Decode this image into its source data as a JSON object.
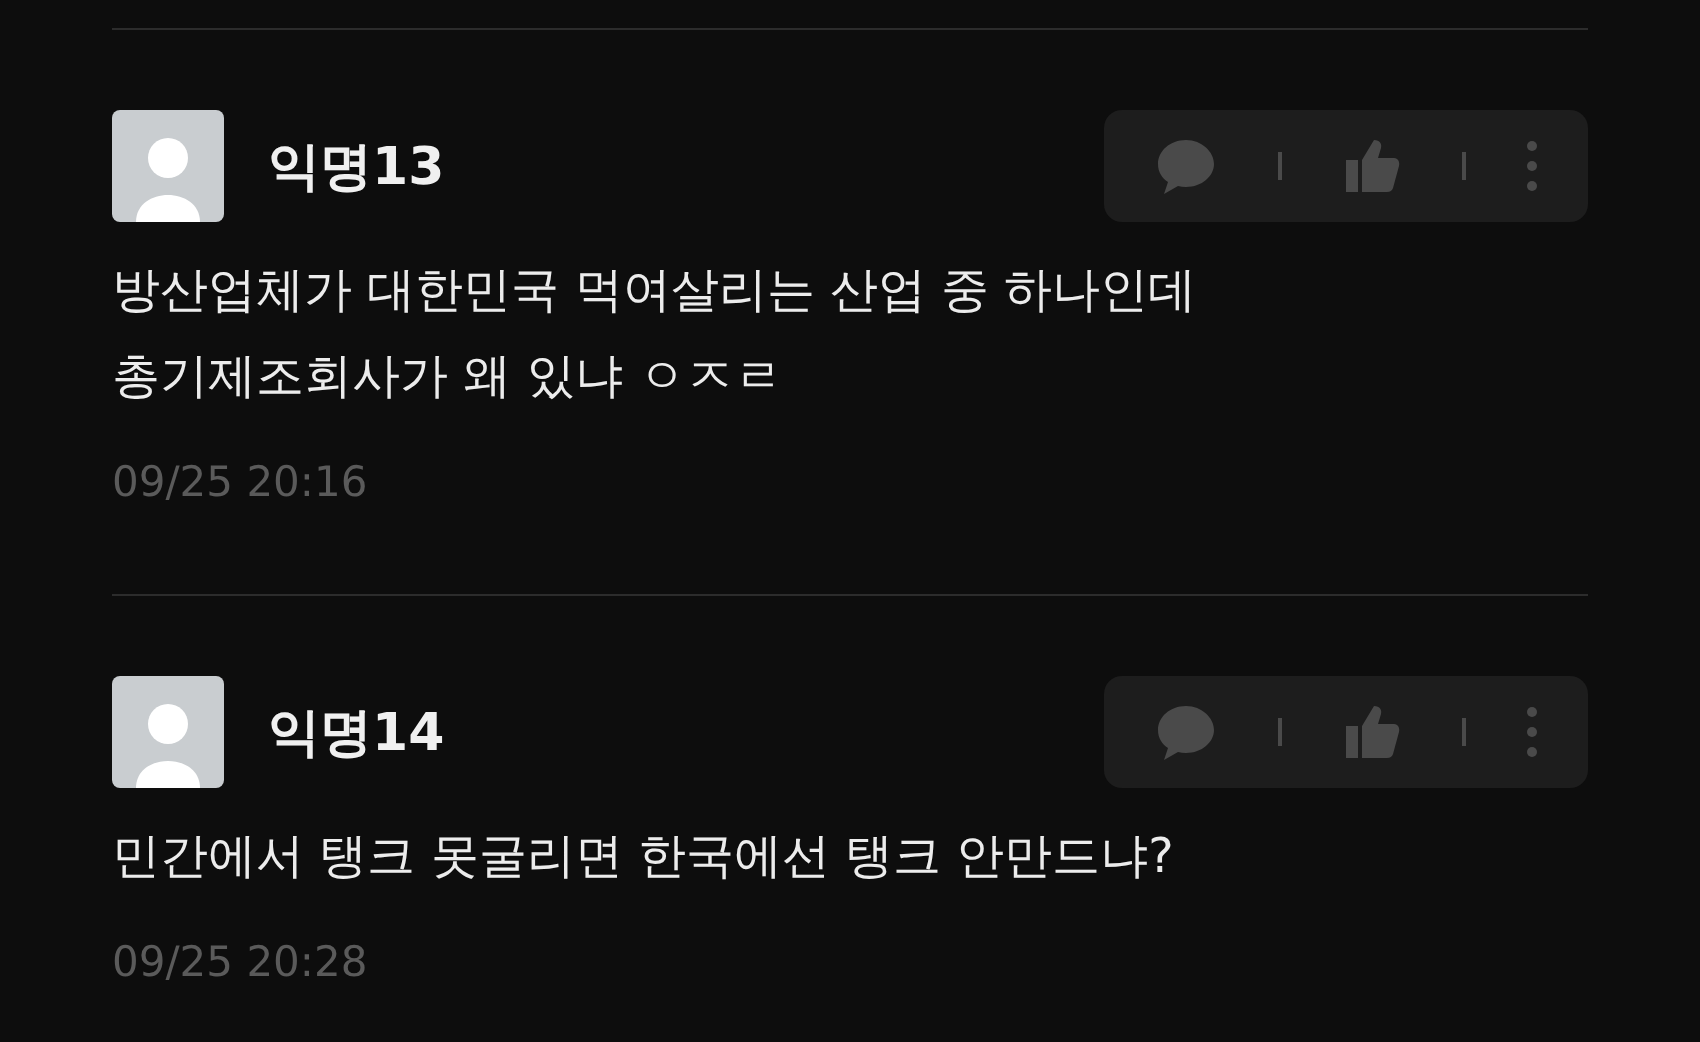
{
  "comments": [
    {
      "author": "익명13",
      "lines": [
        "방산업체가 대한민국 먹여살리는 산업 중 하나인데",
        "총기제조회사가 왜 있냐 ㅇㅈㄹ"
      ],
      "time": "09/25 20:16"
    },
    {
      "author": "익명14",
      "lines": [
        "민간에서 탱크 못굴리면 한국에선 탱크 안만드냐?"
      ],
      "time": "09/25 20:28"
    }
  ]
}
